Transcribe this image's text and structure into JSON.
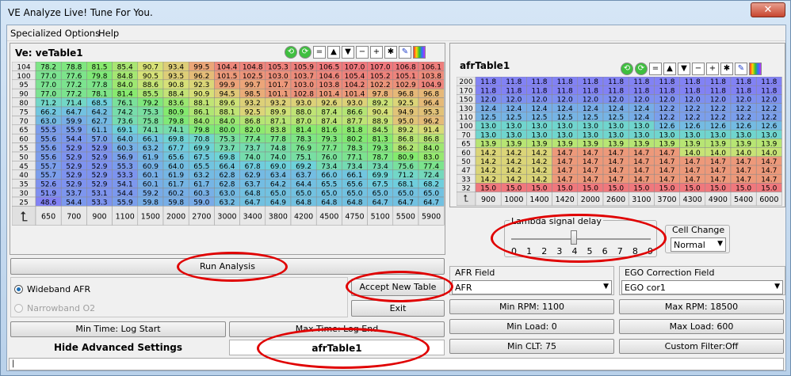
{
  "window": {
    "title": "VE Analyze Live! Tune For You.",
    "close_glyph": "✕"
  },
  "menu": [
    "Specialized Options",
    "Help"
  ],
  "ve": {
    "title": "Ve: veTable1",
    "rows": [
      "104",
      "100",
      "95",
      "90",
      "80",
      "75",
      "70",
      "65",
      "60",
      "55",
      "50",
      "45",
      "40",
      "35",
      "30",
      "25"
    ],
    "cols": [
      "650",
      "700",
      "900",
      "1100",
      "1500",
      "2000",
      "2700",
      "3000",
      "3400",
      "3800",
      "4200",
      "4500",
      "4750",
      "5100",
      "5500",
      "5900"
    ],
    "values": [
      [
        "78.2",
        "78.8",
        "81.5",
        "85.4",
        "90.7",
        "93.4",
        "99.5",
        "104.4",
        "104.8",
        "105.3",
        "105.9",
        "106.5",
        "107.0",
        "107.0",
        "106.8",
        "106.1"
      ],
      [
        "77.0",
        "77.6",
        "79.8",
        "84.8",
        "90.5",
        "93.5",
        "96.2",
        "101.5",
        "102.5",
        "103.0",
        "103.7",
        "104.6",
        "105.4",
        "105.2",
        "105.1",
        "103.8"
      ],
      [
        "77.0",
        "77.2",
        "77.8",
        "84.0",
        "88.6",
        "90.8",
        "92.3",
        "99.9",
        "99.7",
        "101.7",
        "103.0",
        "103.8",
        "104.2",
        "102.2",
        "102.9",
        "104.9"
      ],
      [
        "77.0",
        "77.2",
        "78.1",
        "81.4",
        "85.5",
        "88.4",
        "90.9",
        "94.5",
        "98.5",
        "101.1",
        "102.8",
        "101.4",
        "101.4",
        "97.8",
        "96.8",
        "96.8"
      ],
      [
        "71.2",
        "71.4",
        "68.5",
        "76.1",
        "79.2",
        "83.6",
        "88.1",
        "89.6",
        "93.2",
        "93.2",
        "93.0",
        "92.6",
        "93.0",
        "89.2",
        "92.5",
        "96.4"
      ],
      [
        "66.2",
        "64.7",
        "64.2",
        "74.2",
        "75.3",
        "80.9",
        "86.1",
        "88.1",
        "92.5",
        "89.9",
        "88.0",
        "87.4",
        "86.6",
        "90.4",
        "94.9",
        "95.3"
      ],
      [
        "63.0",
        "59.9",
        "62.7",
        "73.6",
        "75.8",
        "79.8",
        "84.0",
        "84.0",
        "86.8",
        "87.1",
        "87.0",
        "87.4",
        "87.7",
        "88.9",
        "95.0",
        "96.2"
      ],
      [
        "55.5",
        "55.9",
        "61.1",
        "69.1",
        "74.1",
        "74.1",
        "79.8",
        "80.0",
        "82.0",
        "83.8",
        "81.4",
        "81.6",
        "81.8",
        "84.5",
        "89.2",
        "91.4"
      ],
      [
        "55.6",
        "54.4",
        "57.0",
        "64.0",
        "66.1",
        "69.8",
        "70.8",
        "75.3",
        "77.4",
        "77.8",
        "78.3",
        "79.3",
        "80.2",
        "81.3",
        "86.8",
        "86.8"
      ],
      [
        "55.6",
        "52.9",
        "52.9",
        "60.3",
        "63.2",
        "67.7",
        "69.9",
        "73.7",
        "73.7",
        "74.8",
        "76.9",
        "77.7",
        "78.3",
        "79.3",
        "86.2",
        "84.0"
      ],
      [
        "55.6",
        "52.9",
        "52.9",
        "56.9",
        "61.9",
        "65.6",
        "67.5",
        "69.8",
        "74.0",
        "74.0",
        "75.1",
        "76.0",
        "77.1",
        "78.7",
        "80.9",
        "83.0"
      ],
      [
        "55.7",
        "52.9",
        "52.9",
        "55.3",
        "60.9",
        "64.0",
        "65.5",
        "66.4",
        "67.8",
        "69.0",
        "69.2",
        "73.4",
        "73.4",
        "73.4",
        "75.6",
        "77.4"
      ],
      [
        "55.7",
        "52.9",
        "52.9",
        "53.3",
        "60.1",
        "61.9",
        "63.2",
        "62.8",
        "62.9",
        "63.4",
        "63.7",
        "66.0",
        "66.1",
        "69.9",
        "71.2",
        "72.4"
      ],
      [
        "52.6",
        "52.9",
        "52.9",
        "54.1",
        "60.1",
        "61.7",
        "61.7",
        "62.8",
        "63.7",
        "64.2",
        "64.4",
        "65.5",
        "65.6",
        "67.5",
        "68.1",
        "68.2"
      ],
      [
        "51.9",
        "53.7",
        "53.1",
        "54.4",
        "59.2",
        "60.2",
        "60.3",
        "63.0",
        "64.8",
        "65.0",
        "65.0",
        "65.0",
        "65.0",
        "65.0",
        "65.0",
        "65.0"
      ],
      [
        "48.6",
        "54.4",
        "53.3",
        "55.9",
        "59.8",
        "59.8",
        "59.0",
        "63.2",
        "64.7",
        "64.9",
        "64.8",
        "64.8",
        "64.8",
        "64.7",
        "64.7",
        "64.7"
      ]
    ]
  },
  "afr": {
    "title": "afrTable1",
    "rows": [
      "200",
      "170",
      "150",
      "130",
      "110",
      "100",
      "70",
      "65",
      "60",
      "50",
      "47",
      "33",
      "32"
    ],
    "cols": [
      "900",
      "1000",
      "1400",
      "1420",
      "2000",
      "2600",
      "3100",
      "3700",
      "4300",
      "4900",
      "5400",
      "6000"
    ],
    "values": [
      [
        "11.8",
        "11.8",
        "11.8",
        "11.8",
        "11.8",
        "11.8",
        "11.8",
        "11.8",
        "11.8",
        "11.8",
        "11.8",
        "11.8"
      ],
      [
        "11.8",
        "11.8",
        "11.8",
        "11.8",
        "11.8",
        "11.8",
        "11.8",
        "11.8",
        "11.8",
        "11.8",
        "11.8",
        "11.8"
      ],
      [
        "12.0",
        "12.0",
        "12.0",
        "12.0",
        "12.0",
        "12.0",
        "12.0",
        "12.0",
        "12.0",
        "12.0",
        "12.0",
        "12.0"
      ],
      [
        "12.4",
        "12.4",
        "12.4",
        "12.4",
        "12.4",
        "12.4",
        "12.4",
        "12.2",
        "12.2",
        "12.2",
        "12.2",
        "12.2"
      ],
      [
        "12.5",
        "12.5",
        "12.5",
        "12.5",
        "12.5",
        "12.5",
        "12.4",
        "12.2",
        "12.2",
        "12.2",
        "12.2",
        "12.2"
      ],
      [
        "13.0",
        "13.0",
        "13.0",
        "13.0",
        "13.0",
        "13.0",
        "13.0",
        "12.6",
        "12.6",
        "12.6",
        "12.6",
        "12.6"
      ],
      [
        "13.0",
        "13.0",
        "13.0",
        "13.0",
        "13.0",
        "13.0",
        "13.0",
        "13.0",
        "13.0",
        "13.0",
        "13.0",
        "13.0"
      ],
      [
        "13.9",
        "13.9",
        "13.9",
        "13.9",
        "13.9",
        "13.9",
        "13.9",
        "13.9",
        "13.9",
        "13.9",
        "13.9",
        "13.9"
      ],
      [
        "14.2",
        "14.2",
        "14.2",
        "14.7",
        "14.7",
        "14.7",
        "14.7",
        "14.7",
        "14.0",
        "14.0",
        "14.0",
        "14.0"
      ],
      [
        "14.2",
        "14.2",
        "14.2",
        "14.7",
        "14.7",
        "14.7",
        "14.7",
        "14.7",
        "14.7",
        "14.7",
        "14.7",
        "14.7"
      ],
      [
        "14.2",
        "14.2",
        "14.2",
        "14.7",
        "14.7",
        "14.7",
        "14.7",
        "14.7",
        "14.7",
        "14.7",
        "14.7",
        "14.7"
      ],
      [
        "14.2",
        "14.2",
        "14.2",
        "14.7",
        "14.7",
        "14.7",
        "14.7",
        "14.7",
        "14.7",
        "14.7",
        "14.7",
        "14.7"
      ],
      [
        "15.0",
        "15.0",
        "15.0",
        "15.0",
        "15.0",
        "15.0",
        "15.0",
        "15.0",
        "15.0",
        "15.0",
        "15.0",
        "15.0"
      ]
    ]
  },
  "toolbar": {
    "icons": [
      "refresh-left-icon",
      "refresh-right-icon",
      "equals-icon",
      "triangle-up-icon",
      "triangle-down-icon",
      "minus-icon",
      "plus-icon",
      "multiply-icon",
      "pencil-icon",
      "color-palette-icon"
    ],
    "glyphs": [
      "⟲",
      "⟳",
      "=",
      "▲",
      "▼",
      "−",
      "+",
      "✱",
      "✎",
      "▮"
    ]
  },
  "lambda": {
    "label": "Lambda signal delay",
    "ticks": [
      "0",
      "1",
      "2",
      "3",
      "4",
      "5",
      "6",
      "7",
      "8",
      "9"
    ],
    "value": 4
  },
  "cell_change": {
    "label": "Cell Change",
    "value": "Normal"
  },
  "buttons": {
    "run_analysis": "Run Analysis",
    "accept_new_table": "Accept New Table",
    "exit": "Exit",
    "min_time": "Min Time: Log Start",
    "max_time": "Max Time: Log End",
    "hide_advanced": "Hide Advanced Settings",
    "afr_table": "afrTable1"
  },
  "radios": {
    "wideband": "Wideband AFR",
    "narrowband": "Narrowband O2"
  },
  "afr_field": {
    "label": "AFR Field",
    "value": "AFR"
  },
  "ego_field": {
    "label": "EGO Correction Field",
    "value": "EGO cor1"
  },
  "filters": {
    "min_rpm": "Min RPM: 1100",
    "max_rpm": "Max RPM: 18500",
    "min_load": "Min Load: 0",
    "max_load": "Max Load: 600",
    "min_clt": "Min CLT: 75",
    "custom_filter": "Custom Filter:Off"
  },
  "status_text": "|"
}
